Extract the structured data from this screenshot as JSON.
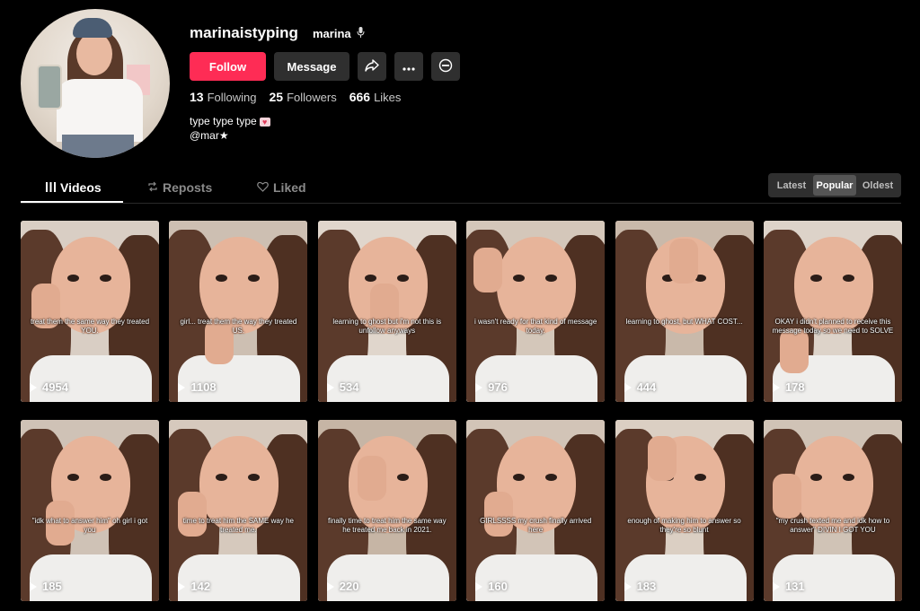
{
  "profile": {
    "username": "marinaistyping",
    "nickname": "marina",
    "nickname_icon": "microphone-icon",
    "buttons": {
      "follow": "Follow",
      "message": "Message"
    },
    "stats": [
      {
        "num": "13",
        "label": "Following"
      },
      {
        "num": "25",
        "label": "Followers"
      },
      {
        "num": "666",
        "label": "Likes"
      }
    ],
    "bio_line1": "type type type",
    "bio_line2": "@mar★"
  },
  "tabs": [
    {
      "label": "Videos",
      "icon": "grid-icon"
    },
    {
      "label": "Reposts",
      "icon": "repost-icon"
    },
    {
      "label": "Liked",
      "icon": "heart-outline-icon"
    }
  ],
  "sort": [
    "Latest",
    "Popular",
    "Oldest"
  ],
  "sort_selected": "Popular",
  "colors": {
    "accent": "#fe2c55",
    "button_bg": "#2f2f2f",
    "background": "#000000"
  },
  "videos": [
    {
      "views": "4954",
      "caption": "treat them the same way they treated YOU."
    },
    {
      "views": "1108",
      "caption": "girl... treat them the way they treated US."
    },
    {
      "views": "534",
      "caption": "learning to ghost but i'm not this is unfollow anyways"
    },
    {
      "views": "976",
      "caption": "i wasn't ready for that kind of message today."
    },
    {
      "views": "444",
      "caption": "learning to ghost, but WHAT COST..."
    },
    {
      "views": "178",
      "caption": "OKAY i didn't planned to receive this message today so we need to SOLVE"
    },
    {
      "views": "185",
      "caption": "\"idk what to answer him\" oh girl i got you"
    },
    {
      "views": "142",
      "caption": "time to treat him the SAME way he treated me."
    },
    {
      "views": "220",
      "caption": "finally time to treat him the same way he treated me back in 2021."
    },
    {
      "views": "160",
      "caption": "GIRLSSSS my crush finally arrived here"
    },
    {
      "views": "183",
      "caption": "enough of making him to answer so they're so blunt"
    },
    {
      "views": "131",
      "caption": "\"my crush texted me and idk how to answer\" DIVIN I GOT YOU"
    }
  ]
}
